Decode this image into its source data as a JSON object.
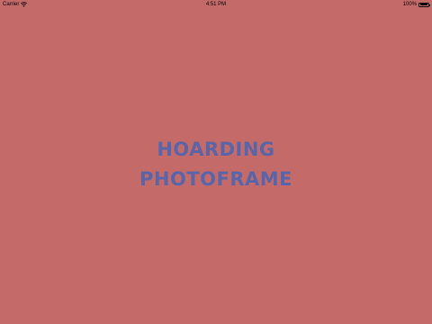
{
  "status_bar": {
    "carrier": "Carrier",
    "time": "4:51 PM",
    "battery_percent": "100%",
    "battery_level": 1.0,
    "wifi_icon": "wifi-icon",
    "battery_icon": "battery-icon"
  },
  "splash": {
    "title_line1": "HOARDING",
    "title_line2": "PHOTOFRAME"
  },
  "colors": {
    "background": "#c46b69",
    "title_text": "#5a64a8"
  }
}
